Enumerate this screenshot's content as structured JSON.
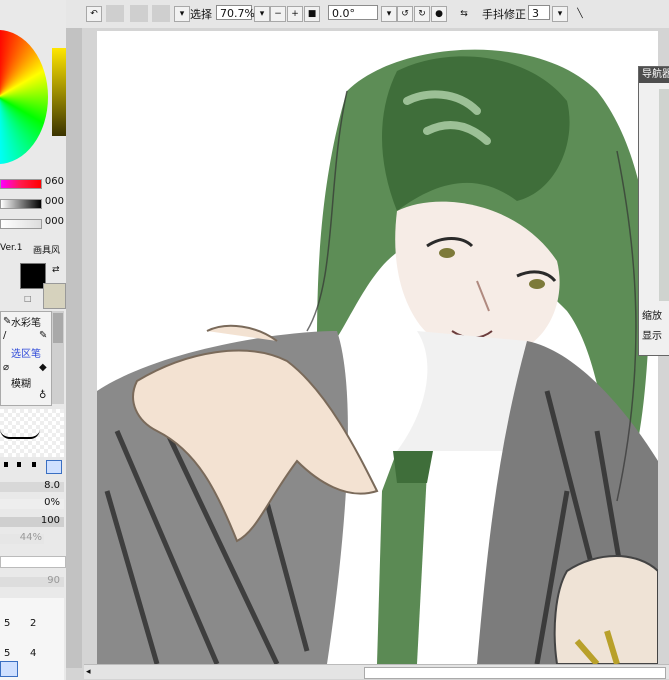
{
  "toolbar": {
    "selection_label": "选择",
    "zoom_value": "70.7%",
    "rotation_value": "0.0°",
    "stabilizer_label": "手抖修正",
    "stabilizer_value": "3"
  },
  "color_panel": {
    "hue_value": "060",
    "saturation_value": "000",
    "luminance_value": "000",
    "version_label": "Ver.1",
    "brush_type_label": "画具风"
  },
  "tool_list": {
    "items": [
      {
        "label": "水彩笔"
      },
      {
        "label": "选区笔"
      },
      {
        "label": "模糊"
      }
    ],
    "selected_item_color": "#2b47d8"
  },
  "brush_settings": {
    "size_value": "8.0",
    "min_size_value": "0%",
    "density_value": "100",
    "blending_value": "44%",
    "water_value": "90"
  },
  "size_grid": {
    "numbers": [
      "5",
      "2",
      "5",
      "4"
    ]
  },
  "navigator": {
    "title": "导航器",
    "zoom_label": "缩放",
    "show_label": "显示"
  },
  "colors": {
    "foreground": "#000000",
    "background": "#d6d2bd",
    "hair_green": "#5b8a54"
  }
}
